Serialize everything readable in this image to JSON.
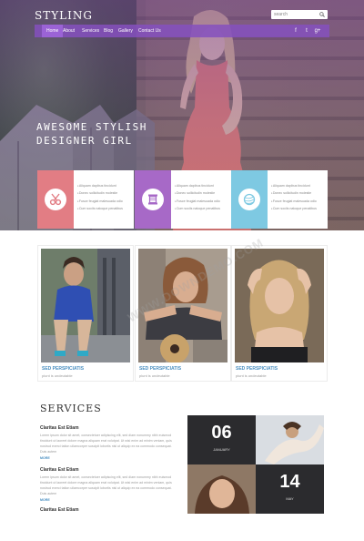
{
  "header": {
    "logo": "STYLING",
    "search_placeholder": "search"
  },
  "nav": {
    "items": [
      "Home",
      "About",
      "Services",
      "Blog",
      "Gallery",
      "Contact Us"
    ],
    "social": [
      "f",
      "t",
      "g+"
    ]
  },
  "hero": {
    "title_line1": "AWESOME STYLISH",
    "title_line2": "DESIGNER GIRL"
  },
  "features": [
    {
      "icon": "scissors-icon",
      "color": "#e27d84",
      "items": [
        "Aliquam dapibus tincidunt",
        "Donec sollicitudin molestie",
        "Fusce feugiat malesuada odio",
        "Cum sociis natoque penatibus"
      ]
    },
    {
      "icon": "thread-spool-icon",
      "color": "#a769c7",
      "items": [
        "Aliquam dapibus tincidunt",
        "Donec sollicitudin molestie",
        "Fusce feugiat malesuada odio",
        "Cum sociis natoque penatibus"
      ]
    },
    {
      "icon": "yarn-ball-icon",
      "color": "#7ec9e2",
      "items": [
        "Aliquam dapibus tincidunt",
        "Donec sollicitudin molestie",
        "Fusce feugiat malesuada odio",
        "Cum sociis natoque penatibus"
      ]
    }
  ],
  "gallery": [
    {
      "title": "SED PERSPICIATIS",
      "subtitle": "piunt is undeutable"
    },
    {
      "title": "SED PERSPICIATIS",
      "subtitle": "piunt is undeutable"
    },
    {
      "title": "SED PERSPICIATIS",
      "subtitle": "piunt is undeutable"
    }
  ],
  "services": {
    "title": "SERVICES",
    "entries": [
      {
        "title": "Claritas Est Etiam",
        "text": "Lorem ipsum dolor sit amet, consectetuer adipiscing elit, sed diam nonummy nibh euismod tincidunt ut laoreet dolore magna aliquam erat volutpat. Ut wisi enim ad minim veniam, quis nostrud exerci tation ullamcorper suscipit lobortis nisl ut aliquip ex ea commodo consequat. Duis autem",
        "more": "MORE"
      },
      {
        "title": "Claritas Est Etiam",
        "text": "Lorem ipsum dolor sit amet, consectetuer adipiscing elit, sed diam nonummy nibh euismod tincidunt ut laoreet dolore magna aliquam erat volutpat. Ut wisi enim ad minim veniam, quis nostrud exerci tation ullamcorper suscipit lobortis nisl ut aliquip ex ea commodo consequat. Duis autem",
        "more": "MORE"
      },
      {
        "title": "Claritas Est Etiam",
        "text": "",
        "more": ""
      }
    ],
    "dates": [
      {
        "day": "06",
        "month": "JANUARY"
      },
      {
        "day": "14",
        "month": "MAY"
      }
    ]
  },
  "watermark": "WWW.DOWNDEMO.COM"
}
